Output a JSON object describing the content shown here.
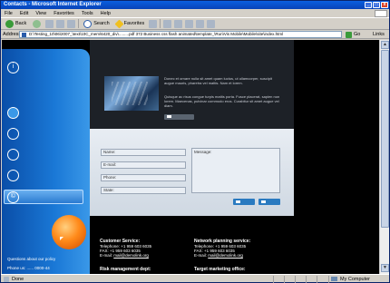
{
  "window": {
    "title": "Contacts - Microsoft Internet Explorer",
    "buttons": [
      "_",
      "□",
      "x"
    ]
  },
  "menu": [
    "File",
    "Edit",
    "View",
    "Favorites",
    "Tools",
    "Help"
  ],
  "toolbar": {
    "back_label": "Back",
    "search_label": "Search",
    "favorites_label": "Favorites"
  },
  "address": {
    "label": "Address",
    "value": "D:\\Testing_10\\06\\2007_\\text\\10C_mem\\6420_div\\.........pdf 372 Business css flash animated\\template_\\Run\\Vis Mobile\\Mobile\\site\\index.html",
    "go_label": "Go",
    "links_label": "Links"
  },
  "left_panel": {
    "icons": [
      "info-icon",
      "globe-icon",
      "gear-icon",
      "circle-icon",
      "circle-icon",
      "copyright-icon"
    ],
    "footer_line1": "Questions about our policy",
    "footer_line2": "Phone us: ......  0000-44"
  },
  "top_block": {
    "paragraph1": "Donec et ornare nulla sit amet quam luctus, ut ullamcorper, suscipit augue mauris, pharetra vel mattis. Nam et lorem.",
    "paragraph2": "Quisque ac risus congue turpis mattis porta. Fusce placerat, sapien non lorem. Maecenas, pulvinar commodo eros. Curabitur sit amet augue vel diam."
  },
  "form": {
    "name_label": "Name:",
    "email_label": "E-mail:",
    "phone_label": "Phone:",
    "state_label": "State:",
    "message_label": "Message:"
  },
  "contacts": {
    "customer_service": {
      "heading": "Customer Service:",
      "telephone": "Telephone:    +1 959 603 6035",
      "fax": "FAX:             +1 959 603 6035",
      "email_prefix": "E-mail: ",
      "email": "mail@demolink.org"
    },
    "network_planning": {
      "heading": "Network planning service:",
      "telephone": "Telephone:    +1 959 603 6035",
      "fax": "FAX:             +1 959 603 6035",
      "email_prefix": "E-mail: ",
      "email": "mail@demolink.org"
    },
    "risk_management": {
      "heading": "Risk management dept:"
    },
    "target_marketing": {
      "heading": "Target marketing office:"
    }
  },
  "status": {
    "left": "Done",
    "zone": "My Computer"
  }
}
